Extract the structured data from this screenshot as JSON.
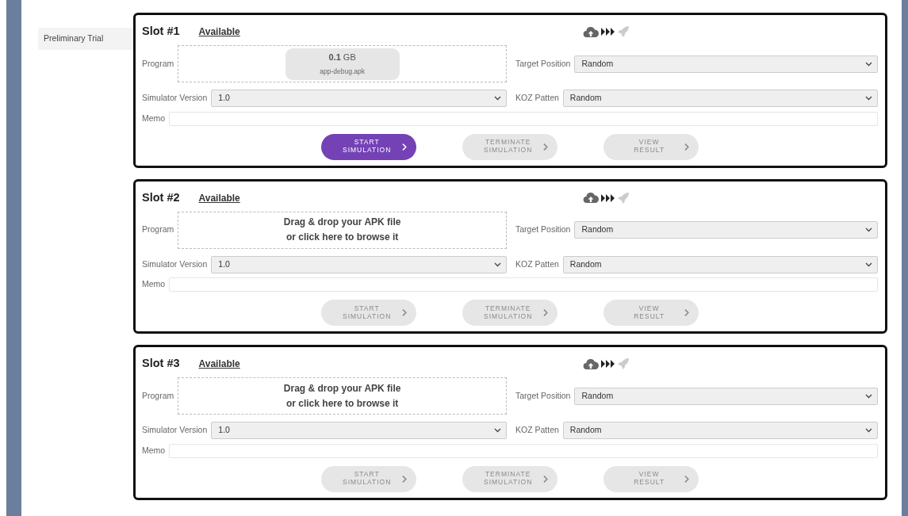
{
  "sidebar": {
    "items": [
      {
        "label": "Preliminary Trial",
        "selected": true
      }
    ]
  },
  "slots": [
    {
      "title": "Slot #1",
      "status": "Available",
      "program_label": "Program",
      "program": {
        "kind": "file",
        "size": "0.1",
        "unit": "GB",
        "filename": "app-debug.apk"
      },
      "target_label": "Target Position",
      "target_value": "Random",
      "version_label": "Simulator Version",
      "version_value": "1.0",
      "koz_label": "KOZ Patten",
      "koz_value": "Random",
      "memo_label": "Memo",
      "buttons": [
        {
          "label": "START SIMULATION",
          "disabled": false
        },
        {
          "label": "TERMINATE SIMULATION",
          "disabled": true
        },
        {
          "label": "VIEW RESULT",
          "disabled": true
        }
      ]
    },
    {
      "title": "Slot #2",
      "status": "Available",
      "program_label": "Program",
      "program": {
        "kind": "empty",
        "hint": "Drag & drop your APK file\nor click here to browse it"
      },
      "target_label": "Target Position",
      "target_value": "Random",
      "version_label": "Simulator Version",
      "version_value": "1.0",
      "koz_label": "KOZ Patten",
      "koz_value": "Random",
      "memo_label": "Memo",
      "buttons": [
        {
          "label": "START SIMULATION",
          "disabled": true
        },
        {
          "label": "TERMINATE SIMULATION",
          "disabled": true
        },
        {
          "label": "VIEW RESULT",
          "disabled": true
        }
      ]
    },
    {
      "title": "Slot #3",
      "status": "Available",
      "program_label": "Program",
      "program": {
        "kind": "empty",
        "hint": "Drag & drop your APK file\nor click here to browse it"
      },
      "target_label": "Target Position",
      "target_value": "Random",
      "version_label": "Simulator Version",
      "version_value": "1.0",
      "koz_label": "KOZ Patten",
      "koz_value": "Random",
      "memo_label": "Memo",
      "buttons": [
        {
          "label": "START SIMULATION",
          "disabled": true
        },
        {
          "label": "TERMINATE SIMULATION",
          "disabled": true
        },
        {
          "label": "VIEW RESULT",
          "disabled": true
        }
      ]
    }
  ]
}
